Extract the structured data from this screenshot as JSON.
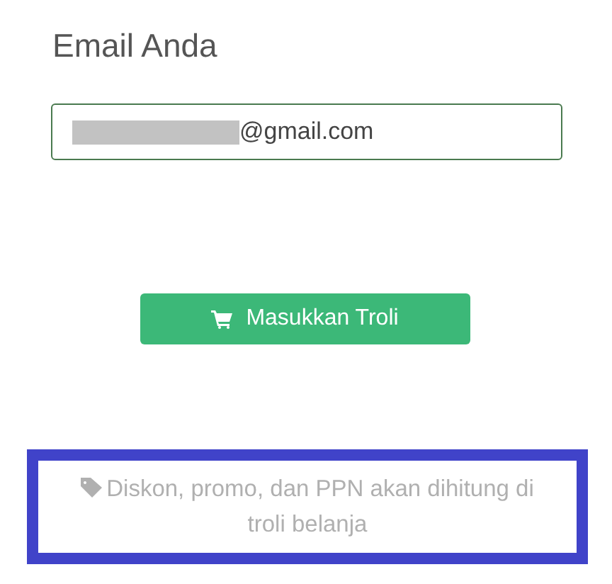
{
  "email_section": {
    "label": "Email Anda",
    "value": "@gmail.com",
    "redacted": true
  },
  "cart_button": {
    "label": "Masukkan Troli"
  },
  "notice": {
    "text": "Diskon, promo, dan PPN akan dihitung di troli belanja",
    "highlighted": true
  }
}
